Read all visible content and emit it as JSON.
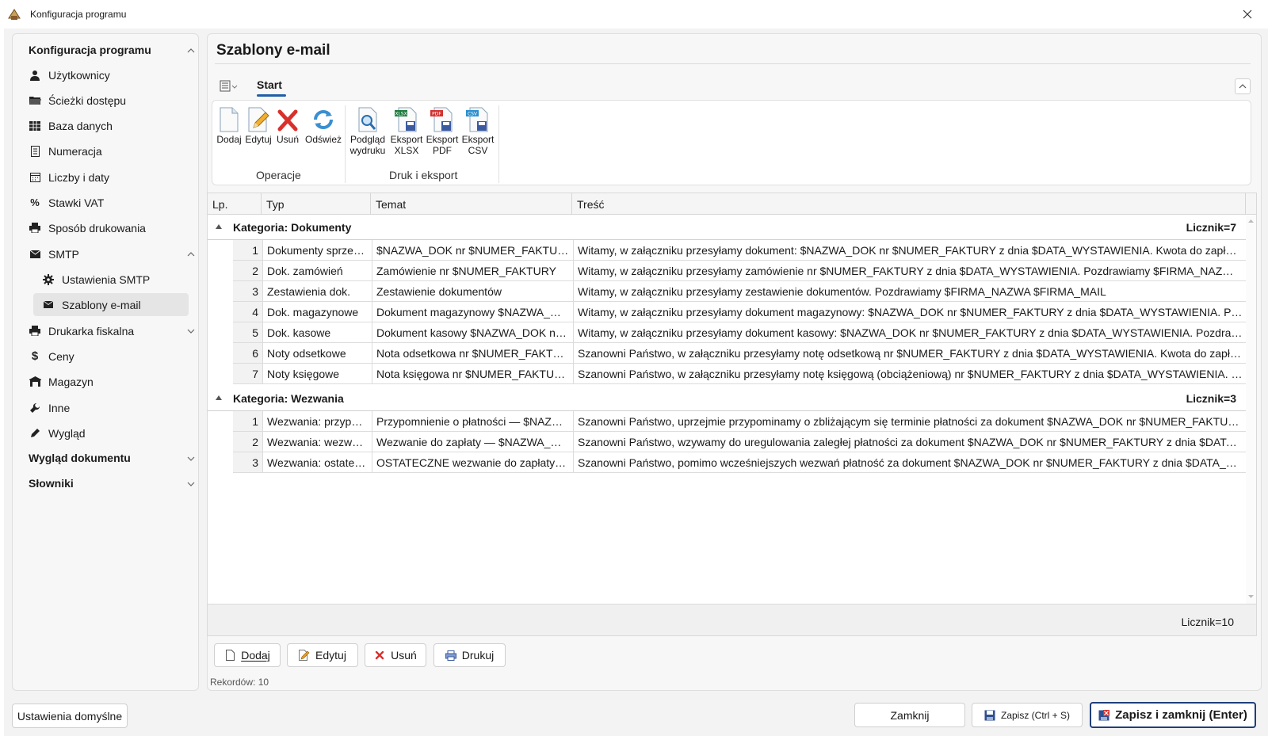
{
  "window": {
    "title": "Konfiguracja programu"
  },
  "sidebar": {
    "group1": "Konfiguracja programu",
    "items": [
      {
        "label": "Użytkownicy",
        "icon": "user-icon"
      },
      {
        "label": "Ścieżki dostępu",
        "icon": "folder-icon"
      },
      {
        "label": "Baza danych",
        "icon": "table-icon"
      },
      {
        "label": "Numeracja",
        "icon": "document-icon"
      },
      {
        "label": "Liczby i daty",
        "icon": "calendar-icon"
      },
      {
        "label": "Stawki VAT",
        "icon": "percent-icon"
      },
      {
        "label": "Sposób drukowania",
        "icon": "printer-icon"
      },
      {
        "label": "SMTP",
        "icon": "mail-icon"
      },
      {
        "label": "Ustawienia SMTP",
        "icon": "gear-icon"
      },
      {
        "label": "Szablony e-mail",
        "icon": "mail-icon"
      },
      {
        "label": "Drukarka fiskalna",
        "icon": "printer-icon"
      },
      {
        "label": "Ceny",
        "icon": "dollar-icon"
      },
      {
        "label": "Magazyn",
        "icon": "warehouse-icon"
      },
      {
        "label": "Inne",
        "icon": "wrench-icon"
      },
      {
        "label": "Wygląd",
        "icon": "pencil-icon"
      }
    ],
    "group2": "Wygląd dokumentu",
    "group3": "Słowniki"
  },
  "page": {
    "title": "Szablony e-mail"
  },
  "ribbon": {
    "tab": "Start",
    "buttons": {
      "add": "Dodaj",
      "edit": "Edytuj",
      "delete": "Usuń",
      "refresh": "Odśwież",
      "preview": [
        "Podgląd",
        "wydruku"
      ],
      "xlsx": [
        "Eksport",
        "XLSX"
      ],
      "pdf": [
        "Eksport",
        "PDF"
      ],
      "csv": [
        "Eksport",
        "CSV"
      ]
    },
    "groups": {
      "ops": "Operacje",
      "print": "Druk i eksport"
    },
    "badges": {
      "xlsx": "XLSX",
      "pdf": "PDF",
      "csv": "CSV"
    }
  },
  "grid": {
    "columns": [
      "Lp.",
      "Typ",
      "Temat",
      "Treść"
    ],
    "categories": [
      {
        "title": "Kategoria: Dokumenty",
        "count": "Licznik=7",
        "rows": [
          [
            "1",
            "Dokumenty sprzedaży",
            "$NAZWA_DOK nr $NUMER_FAKTURY",
            "Witamy, w załączniku przesyłamy dokument: $NAZWA_DOK nr $NUMER_FAKTURY z dnia $DATA_WYSTAWIENIA. Kwota do zapłaty: $KWOTA_DO_ZAPLATY"
          ],
          [
            "2",
            "Dok. zamówień",
            "Zamówienie nr $NUMER_FAKTURY",
            "Witamy, w załączniku przesyłamy zamówienie nr $NUMER_FAKTURY z dnia $DATA_WYSTAWIENIA. Pozdrawiamy $FIRMA_NAZWA $FIRMA_MAIL"
          ],
          [
            "3",
            "Zestawienia dok.",
            "Zestawienie dokumentów",
            "Witamy, w załączniku przesyłamy zestawienie dokumentów. Pozdrawiamy $FIRMA_NAZWA $FIRMA_MAIL"
          ],
          [
            "4",
            "Dok. magazynowe",
            "Dokument magazynowy $NAZWA_DOK nr $NUMER_FAKTURY",
            "Witamy, w załączniku przesyłamy dokument magazynowy: $NAZWA_DOK nr $NUMER_FAKTURY z dnia $DATA_WYSTAWIENIA. Pozdrawiamy $FIRMA_NAZWA"
          ],
          [
            "5",
            "Dok. kasowe",
            "Dokument kasowy $NAZWA_DOK nr $NUMER_FAKTURY",
            "Witamy, w załączniku przesyłamy dokument kasowy: $NAZWA_DOK nr $NUMER_FAKTURY z dnia $DATA_WYSTAWIENIA. Pozdrawiamy $FIRMA_NAZWA"
          ],
          [
            "6",
            "Noty odsetkowe",
            "Nota odsetkowa nr $NUMER_FAKTURY",
            "Szanowni Państwo, w załączniku przesyłamy notę odsetkową nr $NUMER_FAKTURY z dnia $DATA_WYSTAWIENIA. Kwota do zapłaty: $KWOTA_DO_ZAPLATY"
          ],
          [
            "7",
            "Noty księgowe",
            "Nota księgowa nr $NUMER_FAKTURY",
            "Szanowni Państwo, w załączniku przesyłamy notę księgową (obciążeniową) nr $NUMER_FAKTURY z dnia $DATA_WYSTAWIENIA. Kwota do zapłaty"
          ]
        ]
      },
      {
        "title": "Kategoria: Wezwania",
        "count": "Licznik=3",
        "rows": [
          [
            "1",
            "Wezwania: przypomnienie",
            "Przypomnienie o płatności — $NAZWA_DOK nr $NUMER_FAKTURY",
            "Szanowni Państwo, uprzejmie przypominamy o zbliżającym się terminie płatności za dokument $NAZWA_DOK nr $NUMER_FAKTURY z dnia"
          ],
          [
            "2",
            "Wezwania: wezwanie",
            "Wezwanie do zapłaty — $NAZWA_DOK nr $NUMER_FAKTURY",
            "Szanowni Państwo, wzywamy do uregulowania zaległej płatności za dokument $NAZWA_DOK nr $NUMER_FAKTURY z dnia $DATA_WYSTAWIENIA"
          ],
          [
            "3",
            "Wezwania: ostateczne",
            "OSTATECZNE wezwanie do zapłaty — $NAZWA_DOK nr $NUMER_FAKTURY",
            "Szanowni Państwo, pomimo wcześniejszych wezwań płatność za dokument $NAZWA_DOK nr $NUMER_FAKTURY z dnia $DATA_WYSTAWIENIA"
          ]
        ]
      }
    ],
    "total": "Licznik=10"
  },
  "bottom": {
    "add": "Dodaj",
    "edit": "Edytuj",
    "delete": "Usuń",
    "print": "Drukuj",
    "records": "Rekordów: 10"
  },
  "footer": {
    "defaults": "Ustawienia domyślne",
    "close": "Zamknij",
    "save": "Zapisz (Ctrl + S)",
    "save_close": "Zapisz i zamknij (Enter)"
  },
  "colors": {
    "accent": "#1f5fa8",
    "delete": "#d9302c"
  }
}
